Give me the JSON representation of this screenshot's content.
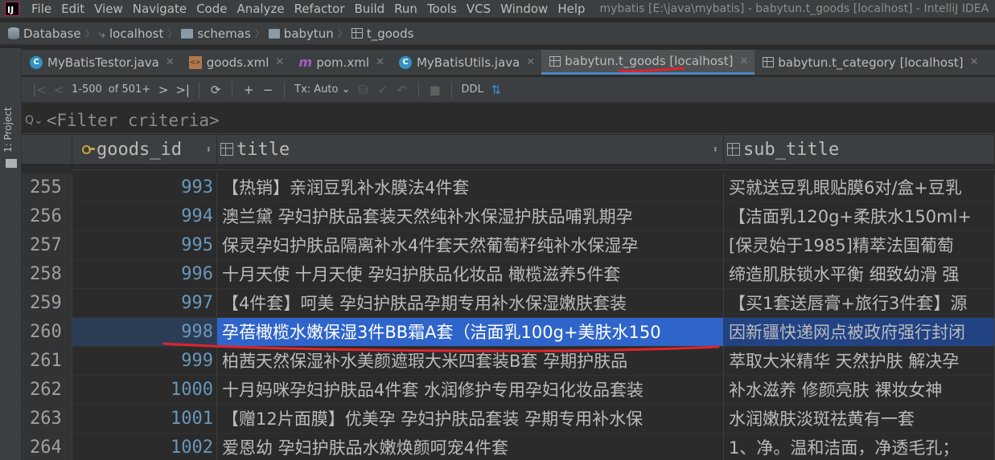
{
  "app": {
    "logo_text": "IJ",
    "menu": [
      "File",
      "Edit",
      "View",
      "Navigate",
      "Code",
      "Analyze",
      "Refactor",
      "Build",
      "Run",
      "Tools",
      "VCS",
      "Window",
      "Help"
    ],
    "window_title": "mybatis [E:\\java\\mybatis] - babytun.t_goods [localhost] - IntelliJ IDEA"
  },
  "breadcrumb": [
    "Database",
    "localhost",
    "schemas",
    "babytun",
    "t_goods"
  ],
  "side_panel": {
    "label": "1: Project"
  },
  "tabs": [
    {
      "label": "MyBatisTestor.java",
      "icon": "class-icon"
    },
    {
      "label": "goods.xml",
      "icon": "xml-icon"
    },
    {
      "label": "pom.xml",
      "icon": "maven-icon"
    },
    {
      "label": "MyBatisUtils.java",
      "icon": "class-icon"
    },
    {
      "label": "babytun.t_goods [localhost]",
      "icon": "table-icon",
      "active": true
    },
    {
      "label": "babytun.t_category [localhost]",
      "icon": "table-icon"
    }
  ],
  "toolbar": {
    "range": "1-500",
    "total": "of 501+",
    "tx_mode": "Tx: Auto",
    "ddl": "DDL"
  },
  "filter": {
    "placeholder": "<Filter criteria>"
  },
  "table": {
    "columns": [
      "goods_id",
      "title",
      "sub_title"
    ],
    "rows": [
      {
        "num": "255",
        "goods_id": "993",
        "title": "【热销】亲润豆乳补水膜法4件套",
        "sub_title": "买就送豆乳眼贴膜6对/盒+豆乳"
      },
      {
        "num": "256",
        "goods_id": "994",
        "title": "澳兰黛 孕妇护肤品套装天然纯补水保湿护肤品哺乳期孕",
        "sub_title": "【洁面乳120g+柔肤水150ml+"
      },
      {
        "num": "257",
        "goods_id": "995",
        "title": "保灵孕妇护肤品隔离补水4件套天然葡萄籽纯补水保湿孕",
        "sub_title": "[保灵始于1985]精萃法国葡萄"
      },
      {
        "num": "258",
        "goods_id": "996",
        "title": "十月天使 十月天使 孕妇护肤品化妆品 橄榄滋养5件套",
        "sub_title": "缔造肌肤锁水平衡 细致幼滑 强"
      },
      {
        "num": "259",
        "goods_id": "997",
        "title": "【4件套】呵美 孕妇护肤品孕期专用补水保湿嫩肤套装",
        "sub_title": "【买1套送唇膏+旅行3件套】源"
      },
      {
        "num": "260",
        "goods_id": "998",
        "title": "孕蓓橄榄水嫩保湿3件BB霜A套（洁面乳100g+美肤水150",
        "sub_title": "因新疆快递网点被政府强行封闭",
        "selected": true
      },
      {
        "num": "261",
        "goods_id": "999",
        "title": "柏茜天然保湿补水美颜遮瑕大米四套装B套 孕期护肤品",
        "sub_title": "萃取大米精华 天然护肤 解决孕"
      },
      {
        "num": "262",
        "goods_id": "1000",
        "title": "十月妈咪孕妇护肤品4件套 水润修护专用孕妇化妆品套装",
        "sub_title": "补水滋养 修颜亮肤 裸妆女神"
      },
      {
        "num": "263",
        "goods_id": "1001",
        "title": "【赠12片面膜】优美孕 孕妇护肤品套装 孕期专用补水保",
        "sub_title": "水润嫩肤淡斑祛黄有一套"
      },
      {
        "num": "264",
        "goods_id": "1002",
        "title": "爱恩幼 孕妇护肤品水嫩焕颜呵宠4件套",
        "sub_title": "1、净。温和洁面，净透毛孔；"
      }
    ]
  },
  "colors": {
    "accent": "#4a88c7",
    "selection": "#2f65ca",
    "annotation": "#e0242c"
  }
}
